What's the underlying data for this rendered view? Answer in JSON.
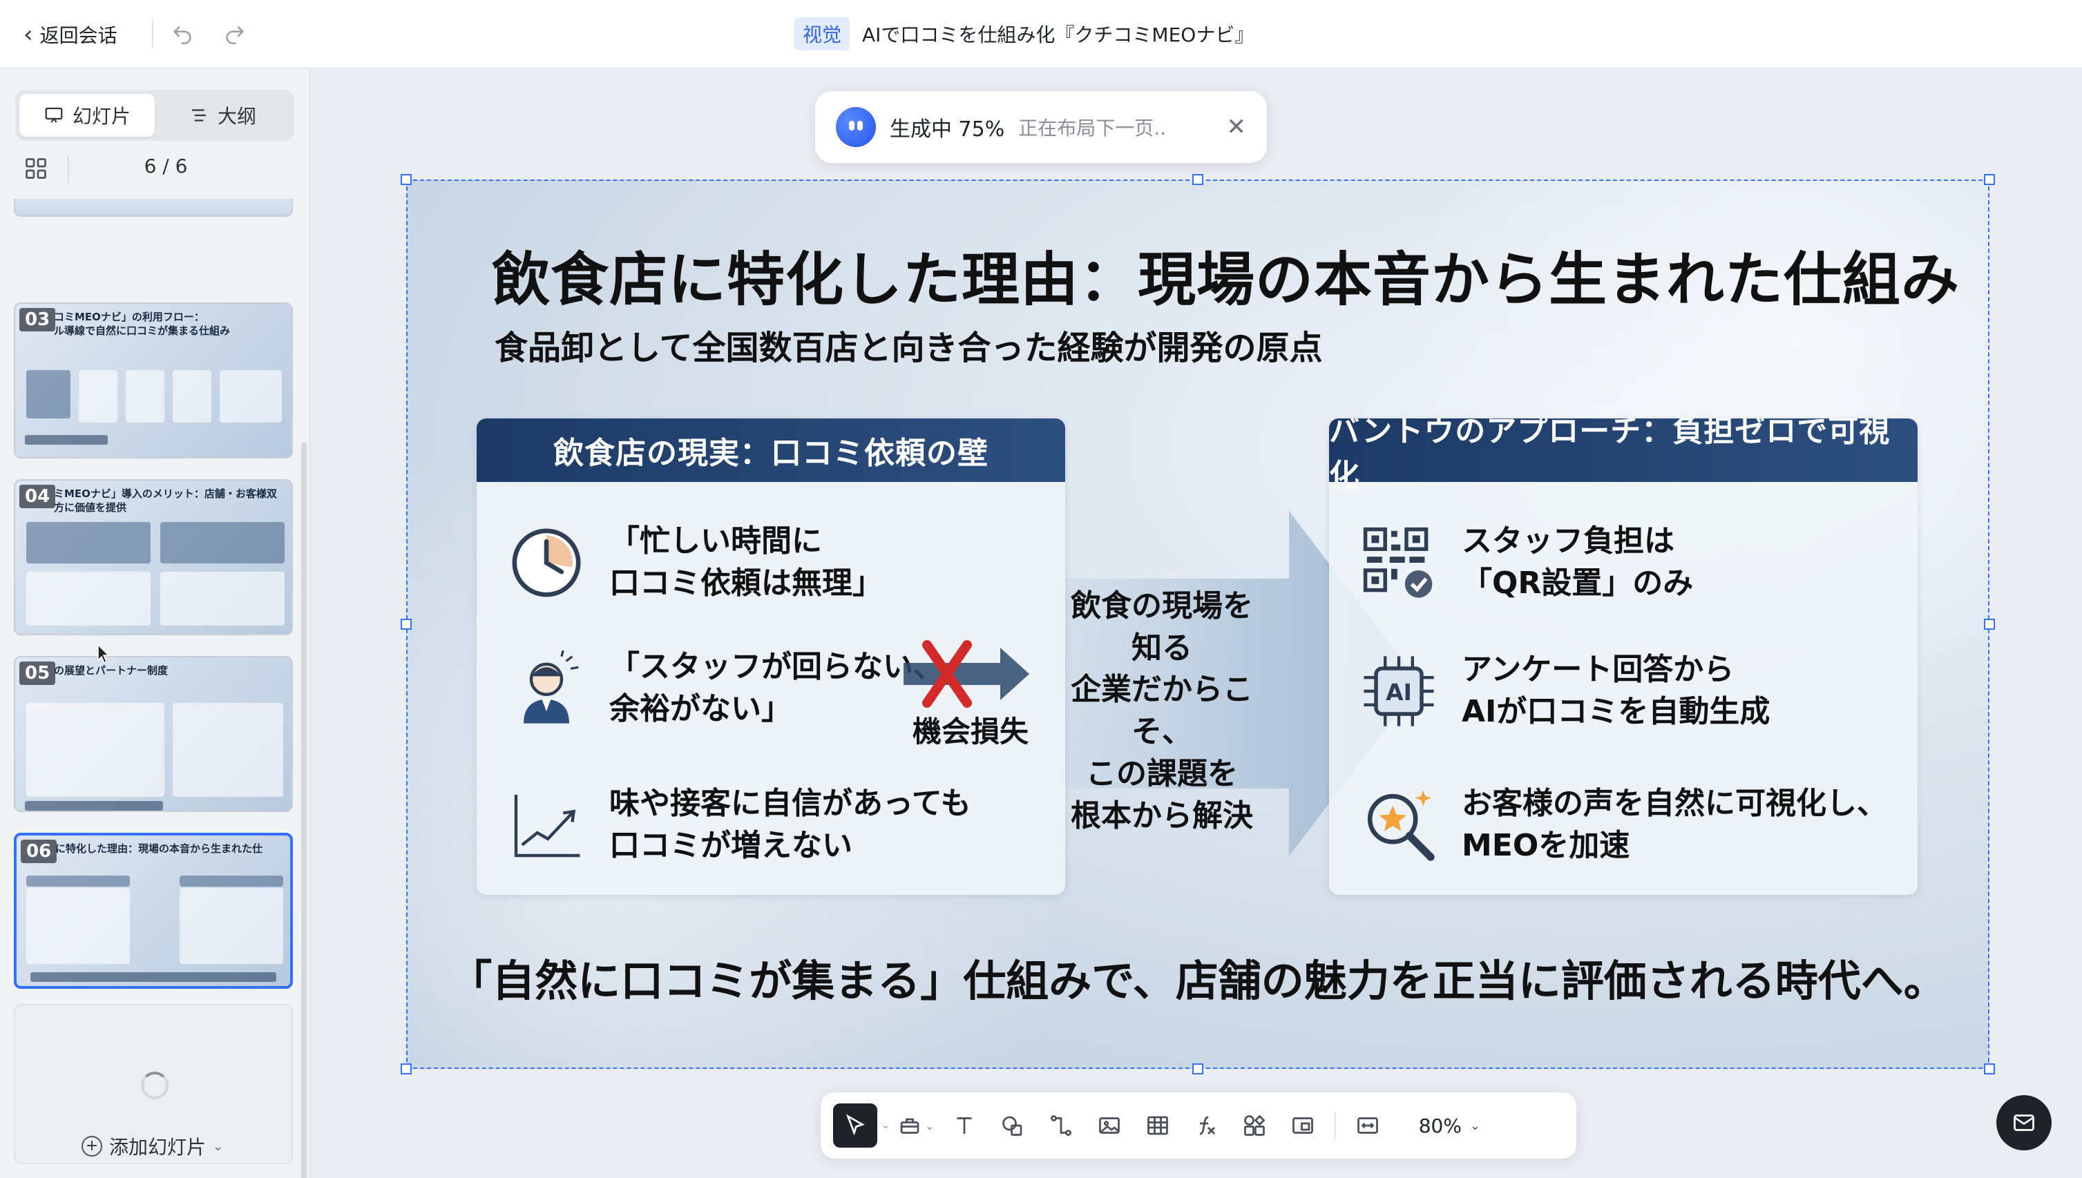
{
  "header": {
    "back_label": "返回会话",
    "tag": "视觉",
    "title": "AIで口コミを仕組み化『クチコミMEOナビ』"
  },
  "sidebar": {
    "tabs": [
      {
        "label": "幻灯片",
        "icon": "slides-icon",
        "active": true
      },
      {
        "label": "大纲",
        "icon": "outline-icon",
        "active": false
      }
    ],
    "counter": "6 / 6",
    "add_label": "添加幻灯片",
    "thumbnails": [
      {
        "num": "03",
        "title": "コミMEOナビ」の利用フロー：\nル導線で自然に口コミが集まる仕組み"
      },
      {
        "num": "04",
        "title": "ミMEOナビ」導入のメリット：店舗・お客様双方に価値を提供"
      },
      {
        "num": "05",
        "title": "の展望とパートナー制度"
      },
      {
        "num": "06",
        "title": "に特化した理由：現場の本音から生まれた仕"
      }
    ]
  },
  "toast": {
    "status": "生成中 75%",
    "detail": "正在布局下一页.."
  },
  "slide": {
    "title": "飲食店に特化した理由：現場の本音から生まれた仕組み",
    "subtitle": "食品卸として全国数百店と向き合った経験が開発の原点",
    "left_panel": {
      "heading": "飲食店の現実：口コミ依頼の壁",
      "items": [
        {
          "icon": "clock-icon",
          "text": "「忙しい時間に\n口コミ依頼は無理」"
        },
        {
          "icon": "stressed-staff-icon",
          "text": "「スタッフが回らない、\n余裕がない」"
        },
        {
          "icon": "trend-chart-icon",
          "text": "味や接客に自信があっても\n口コミが増えない"
        }
      ]
    },
    "loss_label": "機会損失",
    "center_text": "飲食の現場を知る\n企業だからこそ、\nこの課題を\n根本から解決",
    "right_panel": {
      "heading": "バントウのアプローチ：負担ゼロで可視化",
      "items": [
        {
          "icon": "qr-code-icon",
          "text": "スタッフ負担は\n「QR設置」のみ"
        },
        {
          "icon": "ai-chip-icon",
          "text": "アンケート回答から\nAIが口コミを自動生成"
        },
        {
          "icon": "magnifier-star-icon",
          "text": "お客様の声を自然に可視化し、\nMEOを加速"
        }
      ]
    },
    "bottom_message": "「自然に口コミが集まる」仕組みで、店舗の魅力を正当に評価される時代へ。"
  },
  "toolbar": {
    "zoom": "80%"
  },
  "colors": {
    "accent": "#3370ff",
    "panel_header": "#1d3a66",
    "cross": "#d42a2a"
  }
}
